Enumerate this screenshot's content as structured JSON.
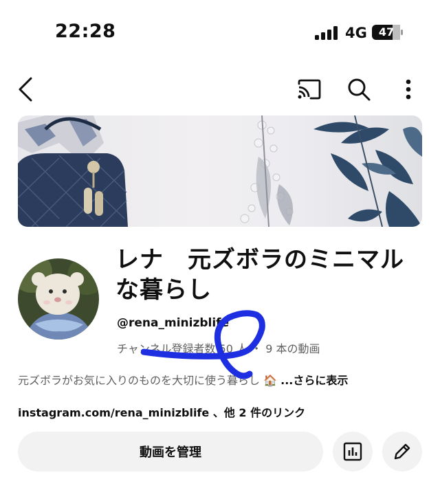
{
  "status_bar": {
    "time": "22:28",
    "network": "4G",
    "battery": "47"
  },
  "nav": {
    "icons": [
      "back-arrow-icon",
      "cast-icon",
      "search-icon",
      "more-vert-icon"
    ]
  },
  "channel": {
    "name": "レナ　元ズボラのミニマルな暮らし",
    "handle": "@rena_minizblife",
    "stats": "チャンネル登録者数 50 人 ・ 9 本の動画",
    "description": "元ズボラがお気に入りのものを大切に使う暮らし 🏠 ",
    "more_label": "...さらに表示",
    "links": "instagram.com/rena_minizblife 、他 2 件のリンク"
  },
  "actions": {
    "manage_label": "動画を管理",
    "icons": [
      "analytics-icon",
      "edit-pencil-icon"
    ]
  },
  "colors": {
    "text": "#0f0f0f",
    "secondary_text": "#606060",
    "button_bg": "#f2f2f2",
    "annotation_scribble": "#1d2fe0"
  }
}
